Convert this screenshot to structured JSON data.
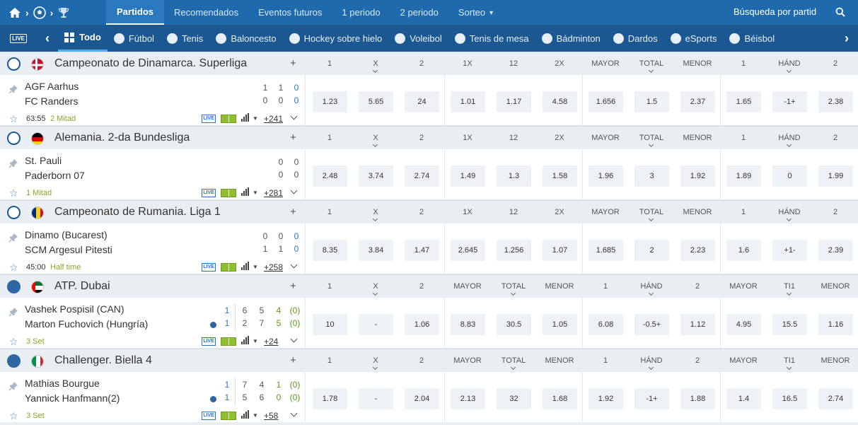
{
  "topbar": {
    "tabs": [
      {
        "label": "Partidos",
        "active": true
      },
      {
        "label": "Recomendados"
      },
      {
        "label": "Eventos futuros"
      },
      {
        "label": "1 periodo"
      },
      {
        "label": "2 periodo"
      },
      {
        "label": "Sorteo"
      }
    ],
    "search_placeholder": "Búsqueda por partid"
  },
  "sportbar": {
    "live_label": "LIVE",
    "items": [
      {
        "label": "Todo",
        "icon": "grid-icon",
        "active": true
      },
      {
        "label": "Fútbol",
        "icon": "soccer-ball-icon"
      },
      {
        "label": "Tenis",
        "icon": "tennis-ball-icon"
      },
      {
        "label": "Baloncesto",
        "icon": "basketball-icon"
      },
      {
        "label": "Hockey sobre hielo",
        "icon": "hockey-icon"
      },
      {
        "label": "Voleibol",
        "icon": "volleyball-icon"
      },
      {
        "label": "Tenis de mesa",
        "icon": "table-tennis-icon"
      },
      {
        "label": "Bádminton",
        "icon": "shuttlecock-icon"
      },
      {
        "label": "Dardos",
        "icon": "darts-icon"
      },
      {
        "label": "eSports",
        "icon": "gamepad-icon"
      },
      {
        "label": "Béisbol",
        "icon": "baseball-icon"
      }
    ]
  },
  "leagues": [
    {
      "name": "Campeonato de Dinamarca. Superliga",
      "sport": "football",
      "flag": "denmark-flag-icon",
      "headers": [
        "1",
        "X",
        "2",
        "1X",
        "12",
        "2X",
        "MAYOR",
        "TOTAL",
        "MENOR",
        "1",
        "HÁND",
        "2"
      ],
      "match": {
        "team1": "AGF Aarhus",
        "team2": "FC Randers",
        "score1": [
          "1",
          "1",
          "0"
        ],
        "score2": [
          "0",
          "0",
          "0"
        ],
        "time": "63:55",
        "period": "2 Mitad",
        "more": "+241",
        "odds": [
          "1.23",
          "5.65",
          "24",
          "1.01",
          "1.17",
          "4.58",
          "1.656",
          "1.5",
          "2.37",
          "1.65",
          "-1+",
          "2.38"
        ]
      }
    },
    {
      "name": "Alemania. 2-da Bundesliga",
      "sport": "football",
      "flag": "germany-flag-icon",
      "headers": [
        "1",
        "X",
        "2",
        "1X",
        "12",
        "2X",
        "MAYOR",
        "TOTAL",
        "MENOR",
        "1",
        "HÁND",
        "2"
      ],
      "match": {
        "team1": "St. Pauli",
        "team2": "Paderborn 07",
        "score1": [
          "0",
          "0"
        ],
        "score2": [
          "0",
          "0"
        ],
        "time": "",
        "period": "1 Mitad",
        "more": "+281",
        "odds": [
          "2.48",
          "3.74",
          "2.74",
          "1.49",
          "1.3",
          "1.58",
          "1.96",
          "3",
          "1.92",
          "1.89",
          "0",
          "1.99"
        ]
      }
    },
    {
      "name": "Campeonato de Rumania. Liga 1",
      "sport": "football",
      "flag": "romania-flag-icon",
      "headers": [
        "1",
        "X",
        "2",
        "1X",
        "12",
        "2X",
        "MAYOR",
        "TOTAL",
        "MENOR",
        "1",
        "HÁND",
        "2"
      ],
      "match": {
        "team1": "Dinamo (Bucarest)",
        "team2": "SCM Argesul Pitesti",
        "score1": [
          "0",
          "0",
          "0"
        ],
        "score2": [
          "1",
          "1",
          "0"
        ],
        "time": "45:00",
        "period": "Half time",
        "more": "+258",
        "odds": [
          "8.35",
          "3.84",
          "1.47",
          "2.645",
          "1.256",
          "1.07",
          "1.685",
          "2",
          "2.23",
          "1.6",
          "+1-",
          "2.39"
        ]
      }
    },
    {
      "name": "ATP. Dubai",
      "sport": "tennis",
      "flag": "uae-flag-icon",
      "headers": [
        "1",
        "X",
        "2",
        "MAYOR",
        "TOTAL",
        "MENOR",
        "1",
        "HÁND",
        "2",
        "MAYOR",
        "TI1",
        "MENOR"
      ],
      "match": {
        "team1": "Vashek Pospisil (CAN)",
        "team2": "Marton Fuchovich (Hungría)",
        "score1": [
          "1",
          "6",
          "5",
          "4",
          "(0)"
        ],
        "score2": [
          "1",
          "2",
          "7",
          "5",
          "(0)"
        ],
        "time": "",
        "period": "3 Set",
        "more": "+24",
        "odds": [
          "10",
          "-",
          "1.06",
          "8.83",
          "30.5",
          "1.05",
          "6.08",
          "-0.5+",
          "1.12",
          "4.95",
          "15.5",
          "1.16"
        ]
      }
    },
    {
      "name": "Challenger. Biella 4",
      "sport": "tennis",
      "flag": "italy-flag-icon",
      "headers": [
        "1",
        "X",
        "2",
        "MAYOR",
        "TOTAL",
        "MENOR",
        "1",
        "HÁND",
        "2",
        "MAYOR",
        "TI1",
        "MENOR"
      ],
      "match": {
        "team1": "Mathias Bourgue",
        "team2": "Yannick Hanfmann(2)",
        "score1": [
          "1",
          "7",
          "4",
          "1",
          "(0)"
        ],
        "score2": [
          "1",
          "5",
          "6",
          "0",
          "(0)"
        ],
        "time": "",
        "period": "3 Set",
        "more": "+58",
        "odds": [
          "1.78",
          "-",
          "2.04",
          "2.13",
          "32",
          "1.68",
          "1.92",
          "-1+",
          "1.88",
          "1.4",
          "16.5",
          "2.74"
        ]
      }
    }
  ],
  "colors": {
    "topbar": "#1e6aad",
    "sportbar": "#1b5791",
    "league_bg": "#e9eef3",
    "odd_bg": "#eef1f5",
    "period": "#8fa32a",
    "blue_score": "#2a74c5",
    "green_score": "#5a9a1a"
  }
}
